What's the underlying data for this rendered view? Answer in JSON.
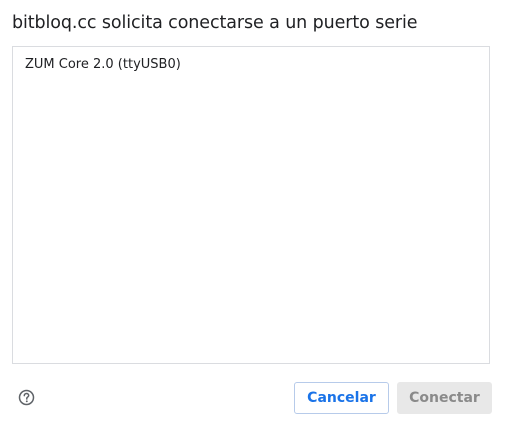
{
  "dialog": {
    "title": "bitbloq.cc solicita conectarse a un puerto serie"
  },
  "port_list": {
    "items": [
      {
        "label": "ZUM Core 2.0 (ttyUSB0)"
      }
    ]
  },
  "footer": {
    "help_icon": "help-circle-icon",
    "cancel_label": "Cancelar",
    "connect_label": "Conectar",
    "connect_enabled": false
  },
  "colors": {
    "accent": "#1a73e8",
    "border": "#dadce0",
    "disabled_bg": "#e8e8e8",
    "disabled_text": "#8a8a8a"
  }
}
